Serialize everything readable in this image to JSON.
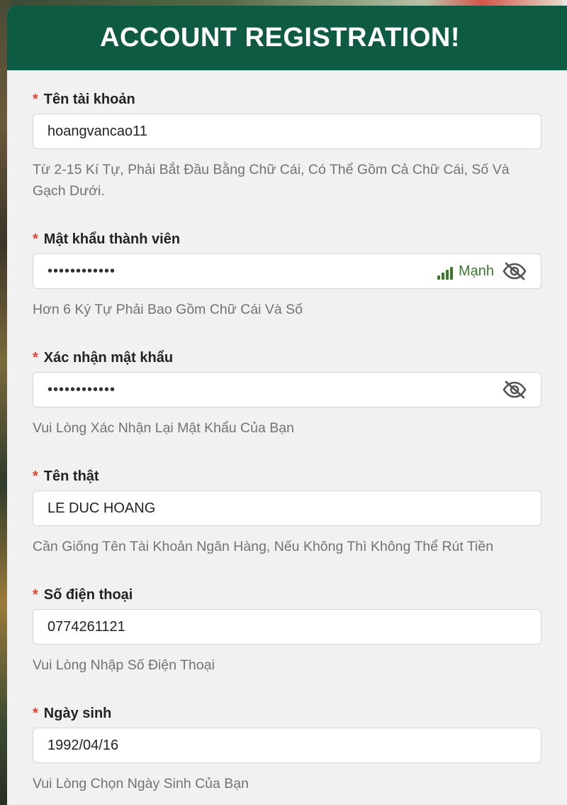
{
  "header": {
    "title": "ACCOUNT REGISTRATION!"
  },
  "colors": {
    "header_bg": "#0f5a43",
    "required": "#e5412d",
    "strength": "#3a7a2a"
  },
  "fields": {
    "username": {
      "required_mark": "*",
      "label": "Tên tài khoản",
      "value": "hoangvancao11",
      "hint": "Từ 2-15 Kí Tự, Phải Bắt Đầu Bằng Chữ Cái, Có Thể Gồm Cả Chữ Cái, Số Và Gạch Dưới."
    },
    "password": {
      "required_mark": "*",
      "label": "Mật khẩu thành viên",
      "value": "••••••••••••",
      "strength_label": "Mạnh",
      "strength_level": 4,
      "strength_max": 4,
      "toggle_icon": "eye-slash-icon",
      "hint": "Hơn 6 Ký Tự Phải Bao Gồm Chữ Cái Và Số"
    },
    "confirm_password": {
      "required_mark": "*",
      "label": "Xác nhận mật khẩu",
      "value": "••••••••••••",
      "toggle_icon": "eye-slash-icon",
      "hint": "Vui Lòng Xác Nhận Lại Mật Khẩu Của Bạn"
    },
    "real_name": {
      "required_mark": "*",
      "label": "Tên thật",
      "value": "LE DUC HOANG",
      "hint": "Cần Giống Tên Tài Khoản Ngân Hàng, Nếu Không Thì Không Thể Rút Tiền"
    },
    "phone": {
      "required_mark": "*",
      "label": "Số điện thoại",
      "value": "0774261121",
      "hint": "Vui Lòng Nhập Số Điện Thoại"
    },
    "birthday": {
      "required_mark": "*",
      "label": "Ngày sinh",
      "value": "1992/04/16",
      "hint": "Vui Lòng Chọn Ngày Sinh Của Bạn"
    }
  }
}
